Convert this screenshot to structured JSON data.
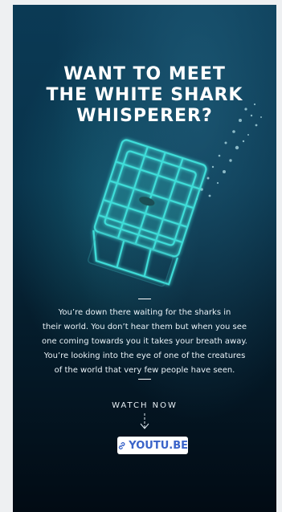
{
  "headline": "WANT TO MEET\nTHE WHITE SHARK\nWHISPERER?",
  "quote": "You’re down there waiting for the sharks in\ntheir world. You don’t hear them but when you see\none coming towards you it takes your breath away.\nYou’re looking into the eye of one of the creatures\nof the world that very few people have seen.",
  "cta": {
    "label": "WATCH NOW",
    "link_text": "YOUTU.BE",
    "link_color": "#3a63c9"
  },
  "colors": {
    "accent_cyan": "#43e6e0",
    "background_deep": "#020b14"
  },
  "icons": [
    "shark-cage-illustration",
    "bubbles",
    "down-arrow-icon",
    "link-icon"
  ]
}
